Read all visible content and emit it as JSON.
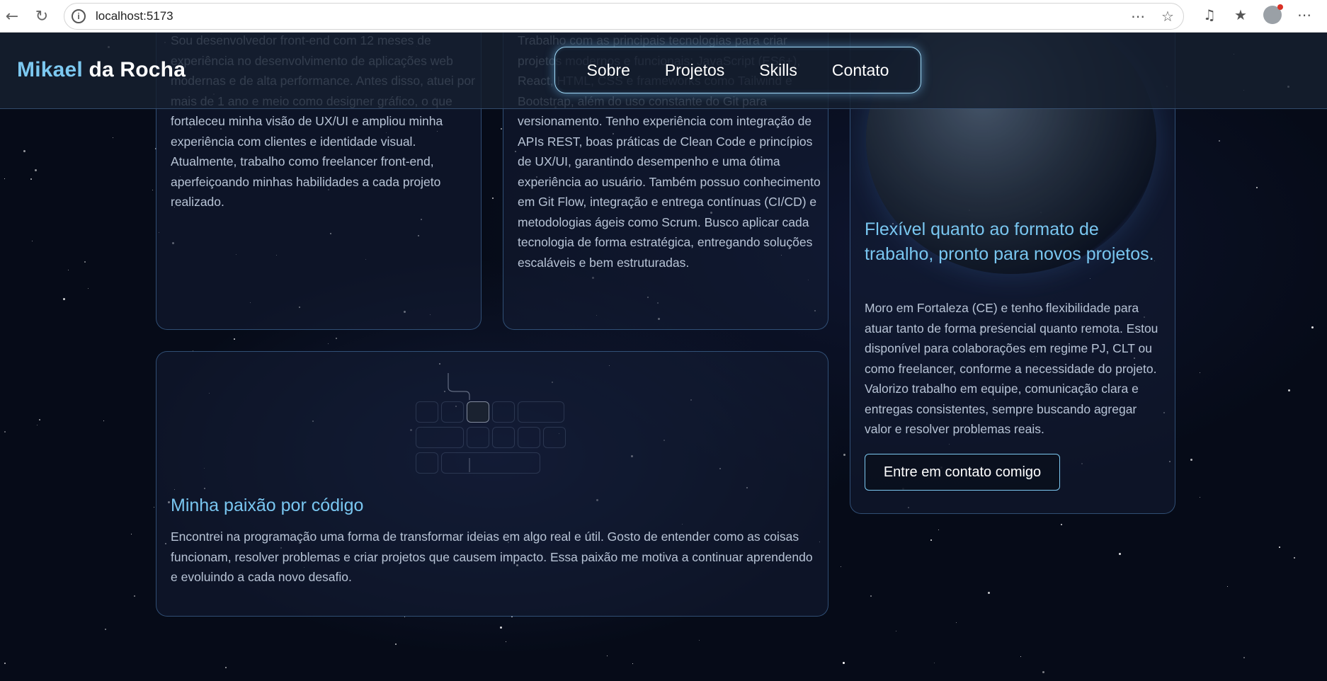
{
  "browser": {
    "url": "localhost:5173"
  },
  "header": {
    "logo_first": "Mikael",
    "logo_rest": " da Rocha",
    "nav": [
      "Sobre",
      "Projetos",
      "Skills",
      "Contato"
    ]
  },
  "cards": {
    "about_text": "Sou desenvolvedor front-end com 12 meses de experiência no desenvolvimento de aplicações web modernas e de alta performance. Antes disso, atuei por mais de 1 ano e meio como designer gráfico, o que fortaleceu minha visão de UX/UI e ampliou minha experiência com clientes e identidade visual. Atualmente, trabalho como freelancer front-end, aperfeiçoando minhas habilidades a cada projeto realizado.",
    "tech_text": "Trabalho com as principais tecnologias para criar projetos modernos e funcionais: JavaScript (ES6+), React, HTML, CSS e frameworks como Tailwind e Bootstrap, além do uso constante do Git para versionamento. Tenho experiência com integração de APIs REST, boas práticas de Clean Code e princípios de UX/UI, garantindo desempenho e uma ótima experiência ao usuário. Também possuo conhecimento em Git Flow, integração e entrega contínuas (CI/CD) e metodologias ágeis como Scrum. Busco aplicar cada tecnologia de forma estratégica, entregando soluções escaláveis e bem estruturadas.",
    "work_title": "Flexível quanto ao formato de trabalho, pronto para novos projetos.",
    "work_text": "Moro em Fortaleza (CE) e tenho flexibilidade para atuar tanto de forma presencial quanto remota. Estou disponível para colaborações em regime PJ, CLT ou como freelancer, conforme a necessidade do projeto. Valorizo trabalho em equipe, comunicação clara e entregas consistentes, sempre buscando agregar valor e resolver problemas reais.",
    "cta_label": "Entre em contato comigo",
    "passion_title": "Minha paixão por código",
    "passion_text": "Encontrei na programação uma forma de transformar ideias em algo real e útil. Gosto de entender como as coisas funcionam, resolver problemas e criar projetos que causem impacto. Essa paixão me motiva a continuar aprendendo e evoluindo a cada novo desafio."
  },
  "colors": {
    "accent": "#7cc8f0",
    "background": "#060b18"
  }
}
